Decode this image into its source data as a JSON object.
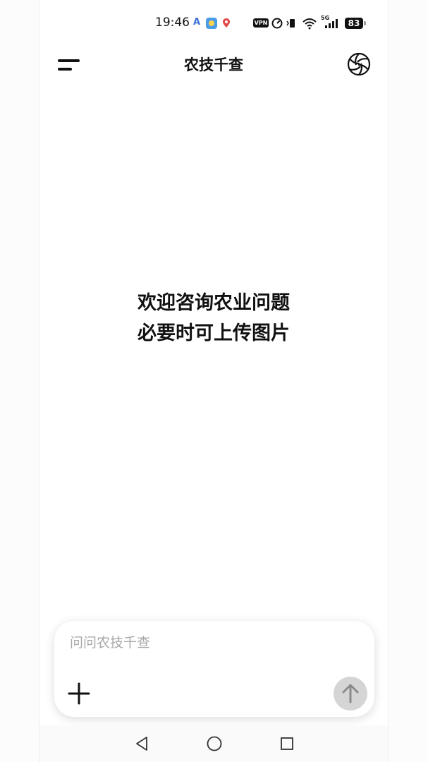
{
  "status_bar": {
    "time": "19:46",
    "vpn_label": "VPN",
    "network_label": "5G",
    "battery_level": "83"
  },
  "header": {
    "title": "农技千查"
  },
  "welcome": {
    "line1": "欢迎咨询农业问题",
    "line2": "必要时可上传图片"
  },
  "composer": {
    "placeholder": "问问农技千查"
  },
  "colors": {
    "send_button_disabled": "#d5d5d5",
    "text_primary": "#111111",
    "placeholder": "#a8a8a8"
  },
  "icons": {
    "menu": "menu-icon",
    "logo": "app-logo-icon",
    "plus": "plus-icon",
    "send": "arrow-up-icon",
    "nav_back": "back-triangle-icon",
    "nav_home": "home-circle-icon",
    "nav_recents": "recents-square-icon"
  }
}
